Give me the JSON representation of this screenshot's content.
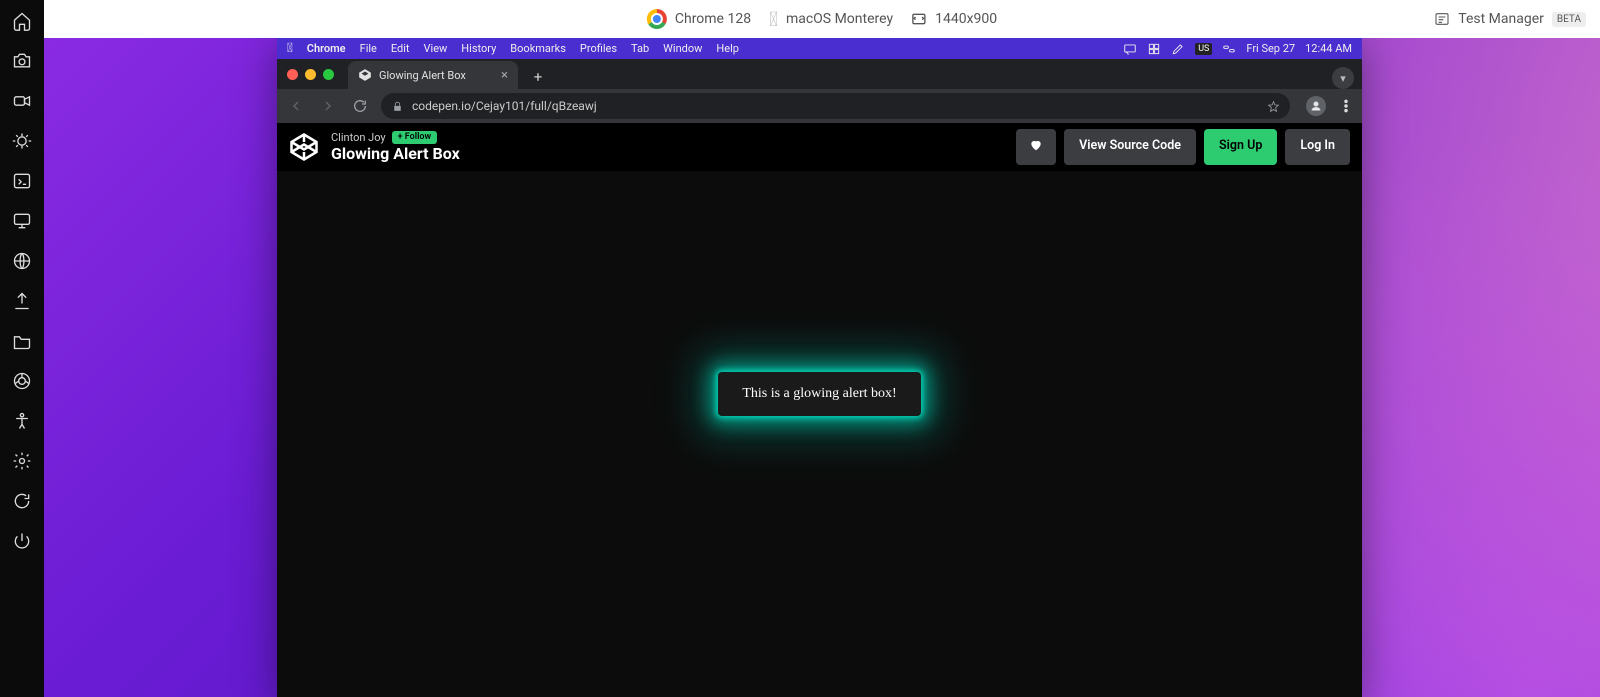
{
  "top_info": {
    "browser": "Chrome 128",
    "os": "macOS Monterey",
    "resolution": "1440x900",
    "test_manager": "Test Manager",
    "beta": "BETA"
  },
  "mac_menubar": {
    "app": "Chrome",
    "menus": [
      "File",
      "Edit",
      "View",
      "History",
      "Bookmarks",
      "Profiles",
      "Tab",
      "Window",
      "Help"
    ],
    "us": "US",
    "date": "Fri Sep 27",
    "time": "12:44 AM"
  },
  "tab": {
    "title": "Glowing Alert Box"
  },
  "omnibox": {
    "url": "codepen.io/Cejay101/full/qBzeawj"
  },
  "codepen": {
    "author": "Clinton Joy",
    "follow": "+ Follow",
    "title": "Glowing Alert Box",
    "view_source": "View Source Code",
    "signup": "Sign Up",
    "login": "Log In"
  },
  "alert_text": "This is a glowing alert box!"
}
